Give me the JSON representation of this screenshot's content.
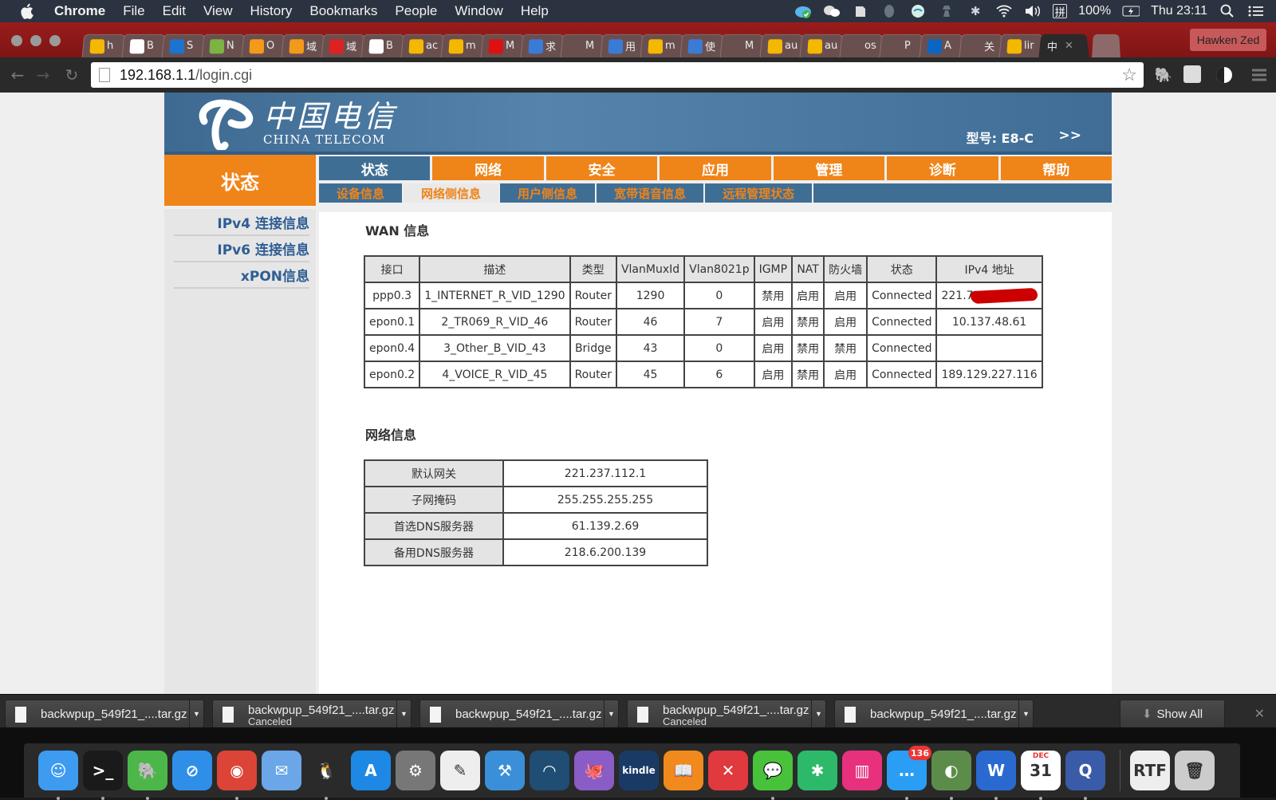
{
  "menubar": {
    "app_name": "Chrome",
    "menus": [
      "File",
      "Edit",
      "View",
      "History",
      "Bookmarks",
      "People",
      "Window",
      "Help"
    ],
    "tray_icons": [
      "icloud-sync-icon",
      "wechat-icon",
      "evernote-icon",
      "qq-icon",
      "network-globe-icon",
      "spy-icon",
      "bluetooth-icon",
      "wifi-icon",
      "volume-icon",
      "input-method-icon"
    ],
    "input_method": "拼",
    "battery": "100%",
    "clock": "Thu 23:11"
  },
  "browser": {
    "tabs": [
      {
        "icon": "bing-icon",
        "label": "h",
        "color": "#f5b800"
      },
      {
        "icon": "face-icon",
        "label": "B",
        "color": "#ffffff"
      },
      {
        "icon": "dsm-icon",
        "label": "S",
        "color": "#1a74d0"
      },
      {
        "icon": "n-icon",
        "label": "N",
        "color": "#7cb342"
      },
      {
        "icon": "cloud-orange-icon",
        "label": "O",
        "color": "#f39a1b"
      },
      {
        "icon": "cloud-orange-icon",
        "label": "域",
        "color": "#f39a1b"
      },
      {
        "icon": "domain-red-icon",
        "label": "域",
        "color": "#d22"
      },
      {
        "icon": "face-icon",
        "label": "B",
        "color": "#ffffff"
      },
      {
        "icon": "bing-icon",
        "label": "ac",
        "color": "#f5b800"
      },
      {
        "icon": "bing-icon",
        "label": "m",
        "color": "#f5b800"
      },
      {
        "icon": "c-red-icon",
        "label": "M",
        "color": "#d11"
      },
      {
        "icon": "m-circle-icon",
        "label": "求",
        "color": "#3a7bd5"
      },
      {
        "icon": "blank-icon",
        "label": "M",
        "color": "transparent"
      },
      {
        "icon": "m-circle-icon",
        "label": "用",
        "color": "#3a7bd5"
      },
      {
        "icon": "bing-icon",
        "label": "m",
        "color": "#f5b800"
      },
      {
        "icon": "m-circle-icon",
        "label": "使",
        "color": "#3a7bd5"
      },
      {
        "icon": "apple-icon",
        "label": "M",
        "color": "transparent"
      },
      {
        "icon": "bing-icon",
        "label": "au",
        "color": "#f5b800"
      },
      {
        "icon": "bing-icon",
        "label": "au",
        "color": "#f5b800"
      },
      {
        "icon": "stackoverflow-icon",
        "label": "os",
        "color": "transparent"
      },
      {
        "icon": "blank-icon",
        "label": "P",
        "color": "transparent"
      },
      {
        "icon": "zhihu-icon",
        "label": "A",
        "color": "#0a66c2"
      },
      {
        "icon": "loading-icon",
        "label": "关",
        "color": "transparent"
      },
      {
        "icon": "bing-icon",
        "label": "lir",
        "color": "#f5b800"
      }
    ],
    "active_tab_label": "中",
    "profile_name": "Hawken Zed",
    "url_host": "192.168.1.1",
    "url_path": "/login.cgi"
  },
  "router": {
    "logo_cn": "中国电信",
    "logo_en": "CHINA TELECOM",
    "model_label": "型号: E8-C",
    "more_link": ">>",
    "section_title": "状态",
    "nav": [
      "状态",
      "网络",
      "安全",
      "应用",
      "管理",
      "诊断",
      "帮助"
    ],
    "subnav": [
      "设备信息",
      "网络侧信息",
      "用户侧信息",
      "宽带语音信息",
      "远程管理状态"
    ],
    "sidebar": [
      "IPv4 连接信息",
      "IPv6 连接信息",
      "xPON信息"
    ],
    "wan": {
      "title": "WAN 信息",
      "columns": [
        "接口",
        "描述",
        "类型",
        "VlanMuxId",
        "Vlan8021p",
        "IGMP",
        "NAT",
        "防火墙",
        "状态",
        "IPv4 地址"
      ],
      "rows": [
        [
          "ppp0.3",
          "1_INTERNET_R_VID_1290",
          "Router",
          "1290",
          "0",
          "禁用",
          "启用",
          "启用",
          "Connected",
          "221.7"
        ],
        [
          "epon0.1",
          "2_TR069_R_VID_46",
          "Router",
          "46",
          "7",
          "启用",
          "禁用",
          "启用",
          "Connected",
          "10.137.48.61"
        ],
        [
          "epon0.4",
          "3_Other_B_VID_43",
          "Bridge",
          "43",
          "0",
          "启用",
          "禁用",
          "禁用",
          "Connected",
          ""
        ],
        [
          "epon0.2",
          "4_VOICE_R_VID_45",
          "Router",
          "45",
          "6",
          "启用",
          "禁用",
          "启用",
          "Connected",
          "189.129.227.116"
        ]
      ]
    },
    "network": {
      "title": "网络信息",
      "rows": [
        {
          "key": "默认网关",
          "value": "221.237.112.1"
        },
        {
          "key": "子网掩码",
          "value": "255.255.255.255"
        },
        {
          "key": "首选DNS服务器",
          "value": "61.139.2.69"
        },
        {
          "key": "备用DNS服务器",
          "value": "218.6.200.139"
        }
      ]
    }
  },
  "downloads": {
    "items": [
      {
        "name": "backwpup_549f21_....tar.gz",
        "status": ""
      },
      {
        "name": "backwpup_549f21_....tar.gz",
        "status": "Canceled"
      },
      {
        "name": "backwpup_549f21_....tar.gz",
        "status": ""
      },
      {
        "name": "backwpup_549f21_....tar.gz",
        "status": "Canceled"
      },
      {
        "name": "backwpup_549f21_....tar.gz",
        "status": ""
      }
    ],
    "show_all": "Show All"
  },
  "dock": {
    "apps": [
      {
        "name": "finder",
        "glyph": "☺",
        "bg": "#3d9bf0",
        "running": true
      },
      {
        "name": "terminal",
        "glyph": ">_",
        "bg": "#1a1a1a",
        "running": true
      },
      {
        "name": "evernote",
        "glyph": "🐘",
        "bg": "#4cb748",
        "running": true
      },
      {
        "name": "safari",
        "glyph": "⊘",
        "bg": "#2f8fe8",
        "running": false
      },
      {
        "name": "chrome",
        "glyph": "◉",
        "bg": "#db4437",
        "running": true
      },
      {
        "name": "mail",
        "glyph": "✉",
        "bg": "#6aa6e8",
        "running": false
      },
      {
        "name": "qq",
        "glyph": "🐧",
        "bg": "#2a2a2a",
        "running": true
      },
      {
        "name": "app-store",
        "glyph": "A",
        "bg": "#1e88e5",
        "running": false
      },
      {
        "name": "system-preferences",
        "glyph": "⚙",
        "bg": "#777",
        "running": false
      },
      {
        "name": "textedit",
        "glyph": "✎",
        "bg": "#eeeeee",
        "running": false
      },
      {
        "name": "xcode",
        "glyph": "⚒",
        "bg": "#3a8fd8",
        "running": false
      },
      {
        "name": "screen-sharing",
        "glyph": "◠",
        "bg": "#1f4d73",
        "running": false
      },
      {
        "name": "github",
        "glyph": "🐙",
        "bg": "#8a5cc6",
        "running": false
      },
      {
        "name": "kindle",
        "glyph": "kindle",
        "bg": "#1a3a66",
        "running": false
      },
      {
        "name": "ibooks",
        "glyph": "📖",
        "bg": "#f08a1c",
        "running": false
      },
      {
        "name": "xmind",
        "glyph": "✕",
        "bg": "#e0393e",
        "running": false
      },
      {
        "name": "wechat",
        "glyph": "💬",
        "bg": "#48c23a",
        "running": true
      },
      {
        "name": "mindnode",
        "glyph": "✱",
        "bg": "#2cb96a",
        "running": false
      },
      {
        "name": "mosaic",
        "glyph": "▥",
        "bg": "#e8317c",
        "running": false
      },
      {
        "name": "messages",
        "glyph": "…",
        "bg": "#2a9df4",
        "running": true,
        "badge": "136"
      },
      {
        "name": "vpn-client",
        "glyph": "◐",
        "bg": "#5c8c4a",
        "running": true
      },
      {
        "name": "word",
        "glyph": "W",
        "bg": "#2a6ad0",
        "running": true
      },
      {
        "name": "calendar",
        "glyph": "31",
        "bg": "#ffffff",
        "running": true,
        "sub": "DEC"
      },
      {
        "name": "quicktime",
        "glyph": "Q",
        "bg": "#3a5ba8",
        "running": true
      }
    ],
    "right": [
      {
        "name": "rtf-document",
        "glyph": "RTF",
        "bg": "#eeeeee"
      },
      {
        "name": "trash",
        "glyph": "🗑",
        "bg": "#cccccc"
      }
    ]
  }
}
